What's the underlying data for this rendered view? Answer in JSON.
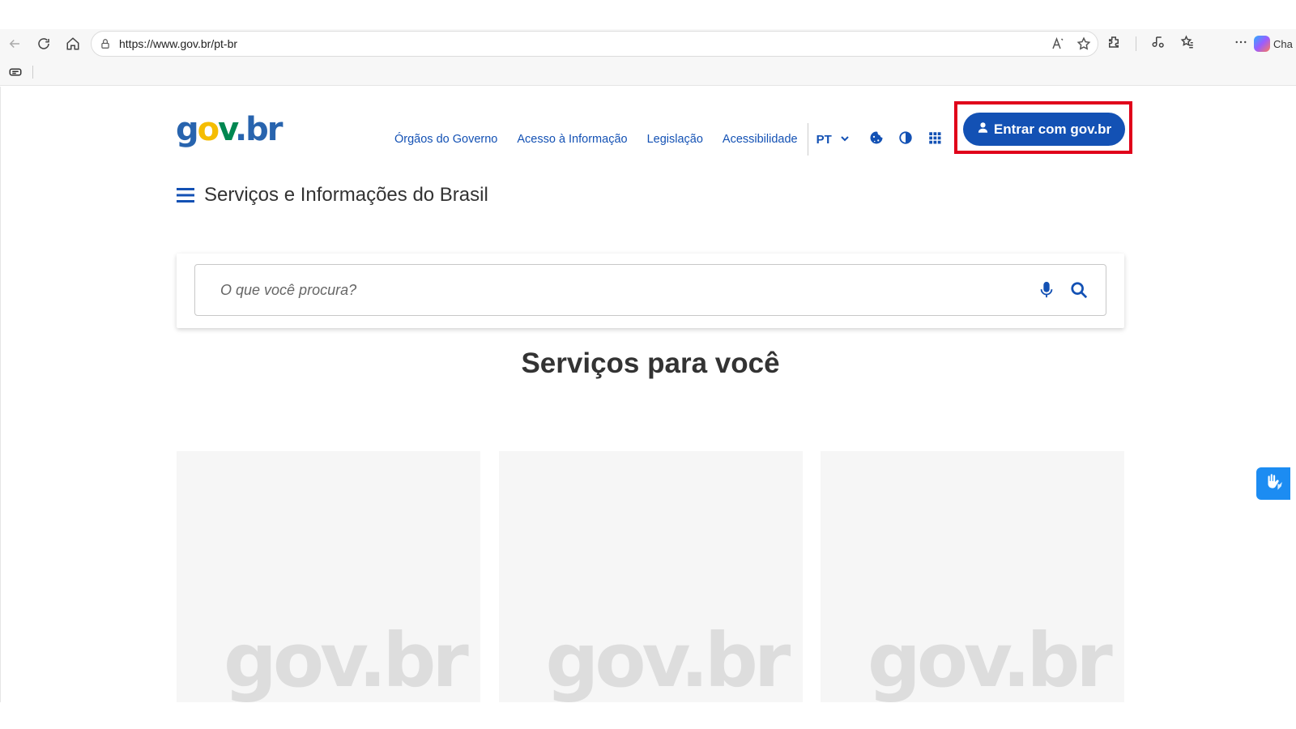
{
  "browser": {
    "url": "https://www.gov.br/pt-br",
    "copilot_label": "Cha",
    "icons": [
      "back-icon",
      "refresh-icon",
      "home-icon",
      "lock-icon",
      "read-aloud-icon",
      "favorite-star-icon",
      "extensions-icon",
      "collections-icon",
      "favorites-icon",
      "more-icon",
      "copilot-icon",
      "tab-actions-icon"
    ]
  },
  "header": {
    "logo": {
      "g": "g",
      "o": "o",
      "v": "v",
      "dot": ".",
      "br": "br"
    },
    "nav": [
      {
        "label": "Órgãos do Governo"
      },
      {
        "label": "Acesso à Informação"
      },
      {
        "label": "Legislação"
      },
      {
        "label": "Acessibilidade"
      }
    ],
    "language": "PT",
    "login_label": "Entrar com gov.br",
    "highlight_color": "#e0001a",
    "accent_color": "#1351b4"
  },
  "menu": {
    "title": "Serviços e Informações do Brasil"
  },
  "search": {
    "placeholder": "O que você procura?"
  },
  "services": {
    "title": "Serviços para você",
    "cards": [
      {
        "watermark": "gov.br"
      },
      {
        "watermark": "gov.br"
      },
      {
        "watermark": "gov.br"
      }
    ]
  }
}
